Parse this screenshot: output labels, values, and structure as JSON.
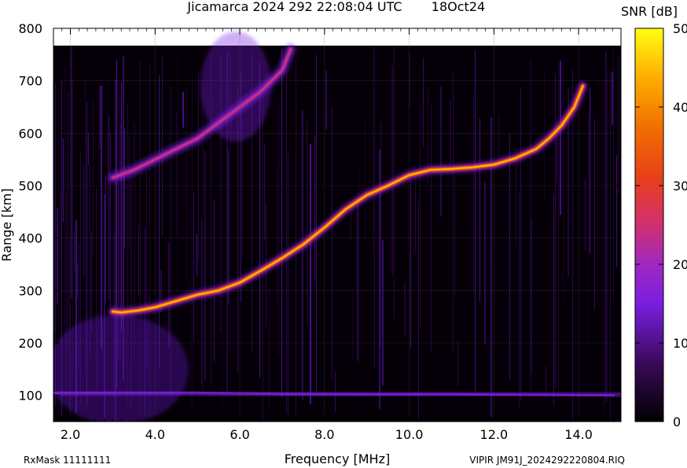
{
  "header": {
    "title": "Jicamarca 2024 292 22:08:04 UTC",
    "date": "18Oct24"
  },
  "colorbar": {
    "label": "SNR [dB]",
    "ticks": [
      "0",
      "10",
      "20",
      "30",
      "40",
      "50"
    ]
  },
  "footer": {
    "left": "RxMask 11111111",
    "right": "VIPIR  JM91J_2024292220804.RIQ"
  },
  "chart_data": {
    "type": "heatmap",
    "title": "Jicamarca 2024 292 22:08:04 UTC",
    "xlabel": "Frequency [MHz]",
    "ylabel": "Range [km]",
    "xlim": [
      1.6,
      15.0
    ],
    "ylim": [
      50,
      800
    ],
    "xticks": [
      "2.0",
      "4.0",
      "6.0",
      "8.0",
      "10.0",
      "12.0",
      "14.0"
    ],
    "yticks": [
      "100",
      "200",
      "300",
      "400",
      "500",
      "600",
      "700",
      "800"
    ],
    "colorbar_range": [
      0,
      50
    ],
    "grid": true,
    "traces": [
      {
        "x": [
          3.0,
          3.2,
          3.6,
          4.0,
          4.5,
          5.0,
          5.5,
          6.0,
          6.5,
          7.0,
          7.5,
          8.0,
          8.5,
          9.0,
          9.5,
          10.0,
          10.5,
          11.0,
          11.5,
          12.0,
          12.5,
          13.0,
          13.3,
          13.6,
          13.9,
          14.1
        ],
        "y": [
          260,
          258,
          262,
          268,
          280,
          292,
          300,
          315,
          338,
          362,
          388,
          420,
          455,
          482,
          500,
          520,
          530,
          532,
          535,
          540,
          552,
          570,
          590,
          615,
          650,
          690
        ]
      },
      {
        "x": [
          3.0,
          3.5,
          4.0,
          4.5,
          5.0,
          5.5,
          6.0,
          6.5,
          7.0,
          7.2
        ],
        "y": [
          515,
          530,
          550,
          570,
          590,
          620,
          650,
          680,
          720,
          760
        ]
      },
      {
        "x": [
          1.6,
          3.0,
          5.0,
          7.0,
          9.0,
          11.0,
          13.0,
          15.0
        ],
        "y": [
          105,
          105,
          105,
          103,
          102,
          102,
          101,
          100
        ]
      }
    ]
  }
}
